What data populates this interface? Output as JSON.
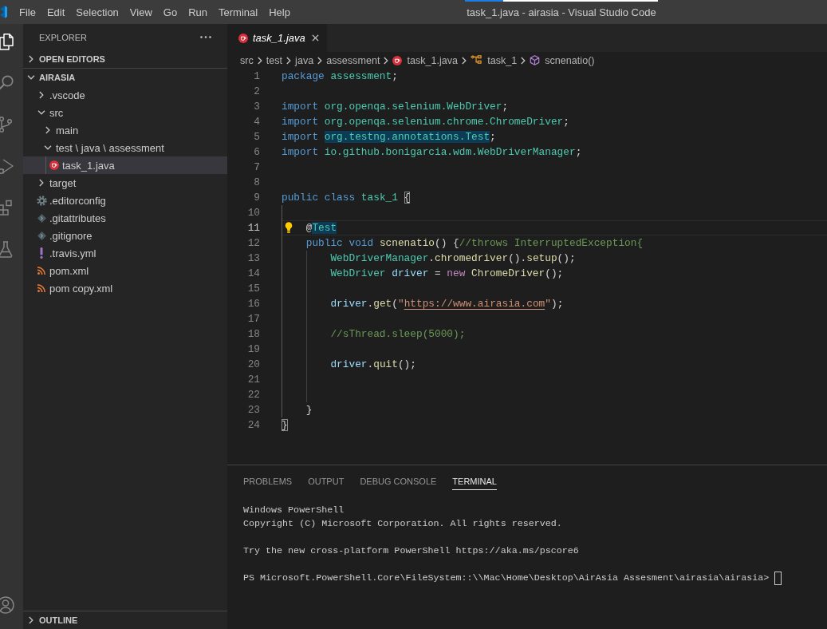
{
  "window": {
    "title": "task_1.java - airasia - Visual Studio Code",
    "progress": {
      "level": 0.2
    }
  },
  "menu": [
    "File",
    "Edit",
    "Selection",
    "View",
    "Go",
    "Run",
    "Terminal",
    "Help"
  ],
  "activity_bar": {
    "items": [
      {
        "kind": "files",
        "selected": true
      },
      {
        "kind": "search",
        "selected": false
      },
      {
        "kind": "source_control",
        "selected": false
      },
      {
        "kind": "run_debug",
        "selected": false
      },
      {
        "kind": "extensions",
        "selected": false
      },
      {
        "kind": "testing",
        "selected": false
      }
    ],
    "bottom": [
      {
        "kind": "account",
        "selected": false
      }
    ]
  },
  "sidebar": {
    "title": "EXPLORER",
    "sections": [
      {
        "title": "OPEN EDITORS",
        "expanded": false
      },
      {
        "title": "AIRASIA",
        "expanded": true,
        "tree": [
          {
            "label": ".vscode",
            "kind": "folder",
            "expanded": false,
            "selected": false
          },
          {
            "label": "src",
            "kind": "folder",
            "expanded": true,
            "selected": false,
            "children": [
              {
                "label": "main",
                "kind": "folder",
                "expanded": false,
                "selected": false
              },
              {
                "label": "test \\ java \\ assessment",
                "kind": "folder",
                "expanded": true,
                "selected": false,
                "children": [
                  {
                    "label": "task_1.java",
                    "kind": "java",
                    "selected": true
                  }
                ]
              }
            ]
          },
          {
            "label": "target",
            "kind": "folder",
            "expanded": false,
            "selected": false
          },
          {
            "label": ".editorconfig",
            "kind": "config",
            "selected": false
          },
          {
            "label": ".gitattributes",
            "kind": "git",
            "selected": false
          },
          {
            "label": ".gitignore",
            "kind": "git",
            "selected": false
          },
          {
            "label": ".travis.yml",
            "kind": "yaml",
            "selected": false
          },
          {
            "label": "pom.xml",
            "kind": "xml",
            "selected": false
          },
          {
            "label": "pom copy.xml",
            "kind": "xml",
            "selected": false
          }
        ]
      },
      {
        "title": "OUTLINE",
        "expanded": false
      }
    ]
  },
  "editor": {
    "tabs": [
      {
        "label": "task_1.java",
        "kind": "java",
        "selected": true,
        "preview": true
      }
    ],
    "breadcrumbs": [
      {
        "label": "src",
        "kind": "folder"
      },
      {
        "label": "test",
        "kind": "folder"
      },
      {
        "label": "java",
        "kind": "folder"
      },
      {
        "label": "assessment",
        "kind": "folder"
      },
      {
        "label": "task_1.java",
        "kind": "java"
      },
      {
        "label": "task_1",
        "kind": "class"
      },
      {
        "label": "scnenatio()",
        "kind": "method"
      }
    ],
    "lines": [
      {
        "number": "1",
        "current": false,
        "lightbulb": false,
        "tokens": [
          {
            "kind": "keyword",
            "text": "package "
          },
          {
            "kind": "type",
            "text": "assessment"
          },
          {
            "kind": "plain",
            "text": ";"
          }
        ]
      },
      {
        "number": "2",
        "current": false,
        "lightbulb": false
      },
      {
        "number": "3",
        "current": false,
        "lightbulb": false,
        "tokens": [
          {
            "kind": "keyword",
            "text": "import "
          },
          {
            "kind": "type",
            "text": "org.openqa.selenium.WebDriver"
          },
          {
            "kind": "plain",
            "text": ";"
          }
        ]
      },
      {
        "number": "4",
        "current": false,
        "lightbulb": false,
        "tokens": [
          {
            "kind": "keyword",
            "text": "import "
          },
          {
            "kind": "type",
            "text": "org.openqa.selenium.chrome.ChromeDriver"
          },
          {
            "kind": "plain",
            "text": ";"
          }
        ]
      },
      {
        "number": "5",
        "current": false,
        "lightbulb": false,
        "tokens": [
          {
            "kind": "keyword",
            "text": "import "
          },
          {
            "kind": "type",
            "text": "org.testng.annotations.Test",
            "highlighted": true
          },
          {
            "kind": "plain",
            "text": ";"
          }
        ]
      },
      {
        "number": "6",
        "current": false,
        "lightbulb": false,
        "tokens": [
          {
            "kind": "keyword",
            "text": "import "
          },
          {
            "kind": "type",
            "text": "io.github.bonigarcia.wdm.WebDriverManager"
          },
          {
            "kind": "plain",
            "text": ";"
          }
        ]
      },
      {
        "number": "7",
        "current": false,
        "lightbulb": false
      },
      {
        "number": "8",
        "current": false,
        "lightbulb": false
      },
      {
        "number": "9",
        "current": false,
        "lightbulb": false,
        "tokens": [
          {
            "kind": "keyword",
            "text": "public class "
          },
          {
            "kind": "type",
            "text": "task_1 "
          },
          {
            "kind": "plain",
            "text": "{",
            "matched": true
          }
        ]
      },
      {
        "number": "10",
        "current": false,
        "lightbulb": false
      },
      {
        "number": "11",
        "current": true,
        "lightbulb": true,
        "tokens": [
          {
            "kind": "plain",
            "text": "    @"
          },
          {
            "kind": "type",
            "text": "Test",
            "highlighted": true
          }
        ]
      },
      {
        "number": "12",
        "current": false,
        "lightbulb": false,
        "tokens": [
          {
            "kind": "keyword",
            "text": "    public void "
          },
          {
            "kind": "function",
            "text": "scnenatio"
          },
          {
            "kind": "plain",
            "text": "() {"
          },
          {
            "kind": "comment",
            "text": "//throws InterruptedException{"
          }
        ]
      },
      {
        "number": "13",
        "current": false,
        "lightbulb": false,
        "tokens": [
          {
            "kind": "type",
            "text": "        WebDriverManager"
          },
          {
            "kind": "plain",
            "text": "."
          },
          {
            "kind": "function",
            "text": "chromedriver"
          },
          {
            "kind": "plain",
            "text": "()."
          },
          {
            "kind": "function",
            "text": "setup"
          },
          {
            "kind": "plain",
            "text": "();"
          }
        ]
      },
      {
        "number": "14",
        "current": false,
        "lightbulb": false,
        "tokens": [
          {
            "kind": "type",
            "text": "        WebDriver "
          },
          {
            "kind": "variable",
            "text": "driver "
          },
          {
            "kind": "plain",
            "text": "= "
          },
          {
            "kind": "control",
            "text": "new "
          },
          {
            "kind": "function",
            "text": "ChromeDriver"
          },
          {
            "kind": "plain",
            "text": "();"
          }
        ]
      },
      {
        "number": "15",
        "current": false,
        "lightbulb": false
      },
      {
        "number": "16",
        "current": false,
        "lightbulb": false,
        "tokens": [
          {
            "kind": "variable",
            "text": "        driver"
          },
          {
            "kind": "plain",
            "text": "."
          },
          {
            "kind": "function",
            "text": "get"
          },
          {
            "kind": "plain",
            "text": "("
          },
          {
            "kind": "string",
            "text": "\""
          },
          {
            "kind": "url",
            "text": "https://www.airasia.com"
          },
          {
            "kind": "string",
            "text": "\""
          },
          {
            "kind": "plain",
            "text": ");"
          }
        ]
      },
      {
        "number": "17",
        "current": false,
        "lightbulb": false
      },
      {
        "number": "18",
        "current": false,
        "lightbulb": false,
        "tokens": [
          {
            "kind": "comment",
            "text": "        //sThread.sleep(5000);"
          }
        ]
      },
      {
        "number": "19",
        "current": false,
        "lightbulb": false
      },
      {
        "number": "20",
        "current": false,
        "lightbulb": false,
        "tokens": [
          {
            "kind": "variable",
            "text": "        driver"
          },
          {
            "kind": "plain",
            "text": "."
          },
          {
            "kind": "function",
            "text": "quit"
          },
          {
            "kind": "plain",
            "text": "();"
          }
        ]
      },
      {
        "number": "21",
        "current": false,
        "lightbulb": false
      },
      {
        "number": "22",
        "current": false,
        "lightbulb": false
      },
      {
        "number": "23",
        "current": false,
        "lightbulb": false,
        "tokens": [
          {
            "kind": "plain",
            "text": "    }"
          }
        ]
      },
      {
        "number": "24",
        "current": false,
        "lightbulb": false,
        "tokens": [
          {
            "kind": "plain",
            "text": "}",
            "matched": true
          }
        ]
      }
    ]
  },
  "panel": {
    "tabs": [
      {
        "label": "PROBLEMS",
        "selected": false
      },
      {
        "label": "OUTPUT",
        "selected": false
      },
      {
        "label": "DEBUG CONSOLE",
        "selected": false
      },
      {
        "label": "TERMINAL",
        "selected": true
      }
    ],
    "terminal": {
      "blocks": [
        [
          "Windows PowerShell",
          "Copyright (C) Microsoft Corporation. All rights reserved."
        ],
        [
          "Try the new cross-platform PowerShell https://aka.ms/pscore6"
        ]
      ],
      "prompt": "PS Microsoft.PowerShell.Core\\FileSystem::\\\\Mac\\Home\\Desktop\\AirAsia Assesment\\airasia\\airasia>"
    }
  }
}
